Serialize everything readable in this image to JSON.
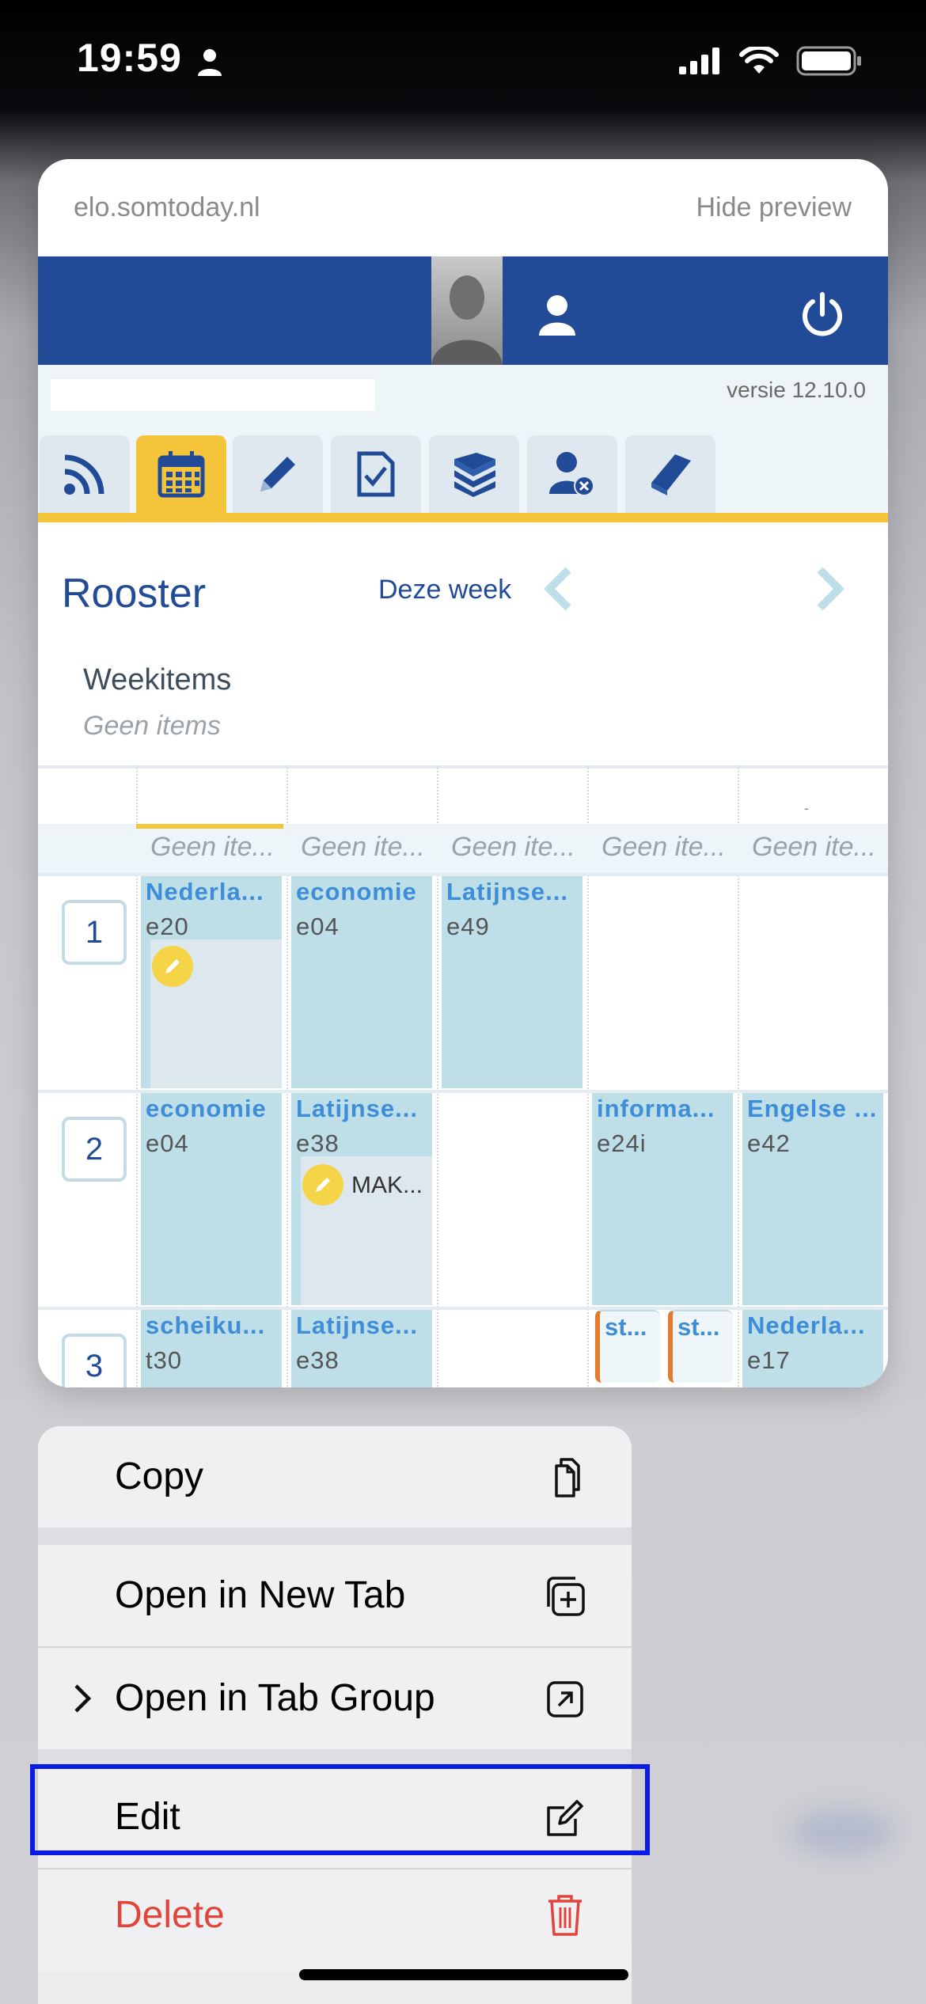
{
  "status_bar": {
    "time": "19:59"
  },
  "preview": {
    "url": "elo.somtoday.nl",
    "hide_preview": "Hide preview",
    "version": "versie 12.10.0",
    "title": "Rooster",
    "week_label": "Deze week",
    "weekitems_label": "Weekitems",
    "weekitems_empty": "Geen items",
    "no_items_cells": [
      "Geen ite...",
      "Geen ite...",
      "Geen ite...",
      "Geen ite...",
      "Geen ite..."
    ],
    "date_marker": "-",
    "rows": [
      {
        "hour": "1",
        "lessons": [
          {
            "subject": "Nederla...",
            "room": "e20"
          },
          {
            "subject": "economie",
            "room": "e04"
          },
          {
            "subject": "Latijnse...",
            "room": "e49"
          }
        ]
      },
      {
        "hour": "2",
        "lessons": [
          {
            "subject": "economie",
            "room": "e04"
          },
          {
            "subject": "Latijnse...",
            "room": "e38",
            "note": "MAK..."
          },
          {
            "subject": "informa...",
            "room": "e24i"
          },
          {
            "subject": "Engelse ...",
            "room": "e42"
          }
        ]
      },
      {
        "hour": "3",
        "lessons": [
          {
            "subject": "scheiku...",
            "room": "t30"
          },
          {
            "subject": "Latijnse...",
            "room": "e38"
          },
          {
            "subject": "st...",
            "room": ""
          },
          {
            "subject": "st...",
            "room": ""
          },
          {
            "subject": "Nederla...",
            "room": "e17"
          }
        ]
      }
    ],
    "nav_icons": [
      "rss-icon",
      "calendar-icon",
      "pencil-icon",
      "checklist-icon",
      "books-icon",
      "user-remove-icon",
      "book-icon"
    ]
  },
  "menu": {
    "copy": "Copy",
    "open_new_tab": "Open in New Tab",
    "open_tab_group": "Open in Tab Group",
    "edit": "Edit",
    "delete": "Delete"
  },
  "colors": {
    "site_blue": "#214b97",
    "accent_yellow": "#f4c43a",
    "lesson_bg": "#bedfe8",
    "delete_red": "#e0443b",
    "highlight_blue": "#0a1be6"
  }
}
